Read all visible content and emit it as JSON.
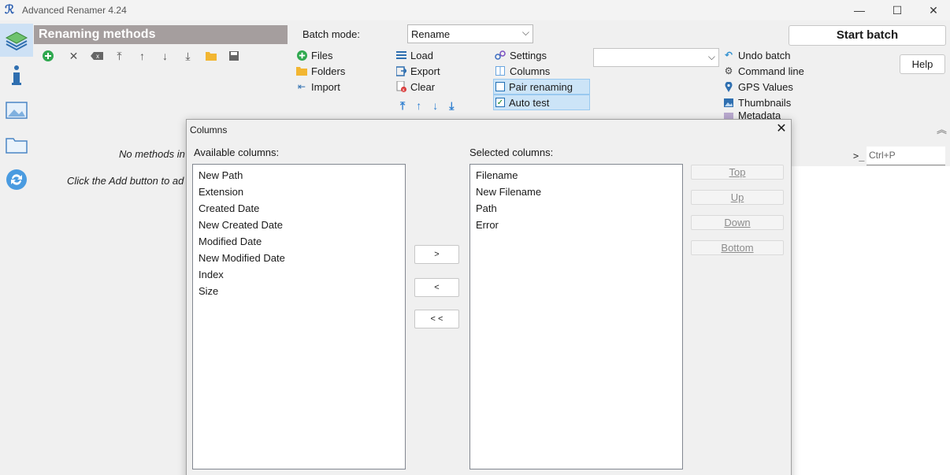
{
  "window": {
    "title": "Advanced Renamer 4.24",
    "minimize": "—",
    "maximize": "☐",
    "close": "✕"
  },
  "sidebar": {
    "items": [
      {
        "name": "methods-icon",
        "active": true
      },
      {
        "name": "info-icon"
      },
      {
        "name": "image-icon"
      },
      {
        "name": "folder-icon"
      },
      {
        "name": "refresh-icon"
      }
    ]
  },
  "methods": {
    "header": "Renaming methods",
    "empty_line1": "No methods in",
    "empty_line2": "Click the Add button to ad"
  },
  "batch": {
    "label": "Batch mode:",
    "value": "Rename"
  },
  "toolbar": {
    "files": "Files",
    "folders": "Folders",
    "import": "Import",
    "load": "Load",
    "export": "Export",
    "clear": "Clear",
    "settings": "Settings",
    "columns": "Columns",
    "pair_renaming": "Pair renaming",
    "auto_test": "Auto test",
    "undo_batch": "Undo batch",
    "command_line": "Command line",
    "gps_values": "GPS Values",
    "thumbnails": "Thumbnails",
    "metadata": "Metadata"
  },
  "actions": {
    "start_batch": "Start batch",
    "help": "Help"
  },
  "command": {
    "placeholder": "Ctrl+P"
  },
  "dialog": {
    "title": "Columns",
    "close": "✕",
    "available_label": "Available columns:",
    "selected_label": "Selected columns:",
    "available": [
      "New Path",
      "Extension",
      "Created Date",
      "New Created Date",
      "Modified Date",
      "New Modified Date",
      "Index",
      "Size"
    ],
    "selected": [
      "Filename",
      "New Filename",
      "Path",
      "Error"
    ],
    "add_btn": ">",
    "remove_btn": "<",
    "remove_all_btn": "< <",
    "top_btn": "Top",
    "up_btn": "Up",
    "down_btn": "Down",
    "bottom_btn": "Bottom"
  }
}
